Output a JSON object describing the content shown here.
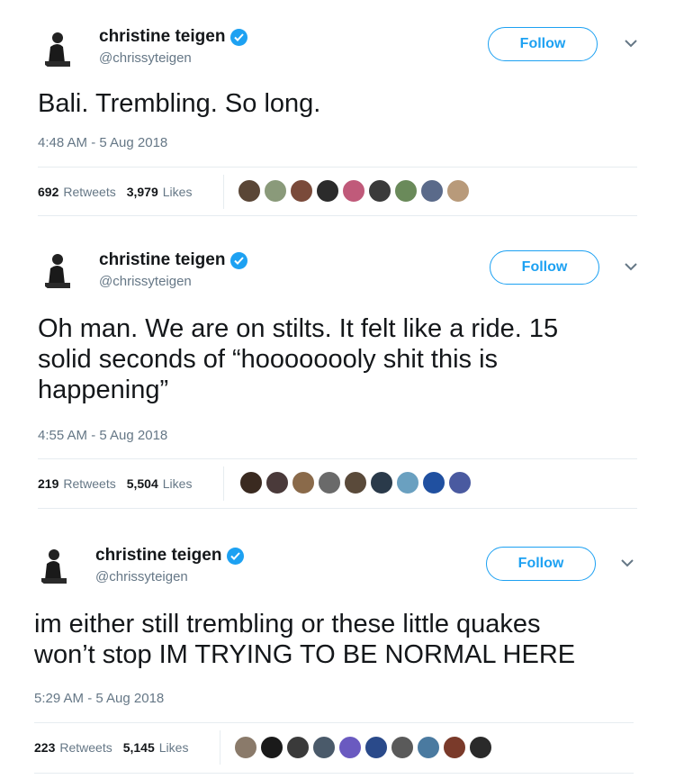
{
  "tweets": [
    {
      "user": {
        "name": "christine teigen",
        "handle": "@chrissyteigen"
      },
      "follow_label": "Follow",
      "text_lines": [
        "Bali. Trembling. So long."
      ],
      "timestamp": "4:48 AM - 5 Aug 2018",
      "retweets": "692",
      "retweets_label": "Retweets",
      "likes": "3,979",
      "likes_label": "Likes",
      "liker_colors": [
        "#5a4636",
        "#8a9a7a",
        "#7a4a3a",
        "#2b2b2b",
        "#c05a7a",
        "#3a3a3a",
        "#6a8a5a",
        "#5a6a8a",
        "#b89a7a"
      ]
    },
    {
      "user": {
        "name": "christine teigen",
        "handle": "@chrissyteigen"
      },
      "follow_label": "Follow",
      "text_lines": [
        "Oh man. We are on stilts. It felt like a ride. 15",
        "solid seconds of “hoooooooly shit this is",
        "happening”"
      ],
      "timestamp": "4:55 AM - 5 Aug 2018",
      "retweets": "219",
      "retweets_label": "Retweets",
      "likes": "5,504",
      "likes_label": "Likes",
      "liker_colors": [
        "#3a2a20",
        "#4a3a3a",
        "#8a6a4a",
        "#6a6a6a",
        "#5a4a3a",
        "#2a3a4a",
        "#6aa0c0",
        "#2050a0",
        "#4a5aa0"
      ]
    },
    {
      "user": {
        "name": "christine teigen",
        "handle": "@chrissyteigen"
      },
      "follow_label": "Follow",
      "text_lines": [
        "im either still trembling or these little quakes",
        "won’t stop IM TRYING TO BE NORMAL HERE"
      ],
      "timestamp": "5:29 AM - 5 Aug 2018",
      "retweets": "223",
      "retweets_label": "Retweets",
      "likes": "5,145",
      "likes_label": "Likes",
      "liker_colors": [
        "#8a7a6a",
        "#1a1a1a",
        "#3a3a3a",
        "#4a5a6a",
        "#6a5ac0",
        "#2a4a8a",
        "#5a5a5a",
        "#4a7aa0",
        "#7a3a2a",
        "#2a2a2a"
      ]
    }
  ]
}
